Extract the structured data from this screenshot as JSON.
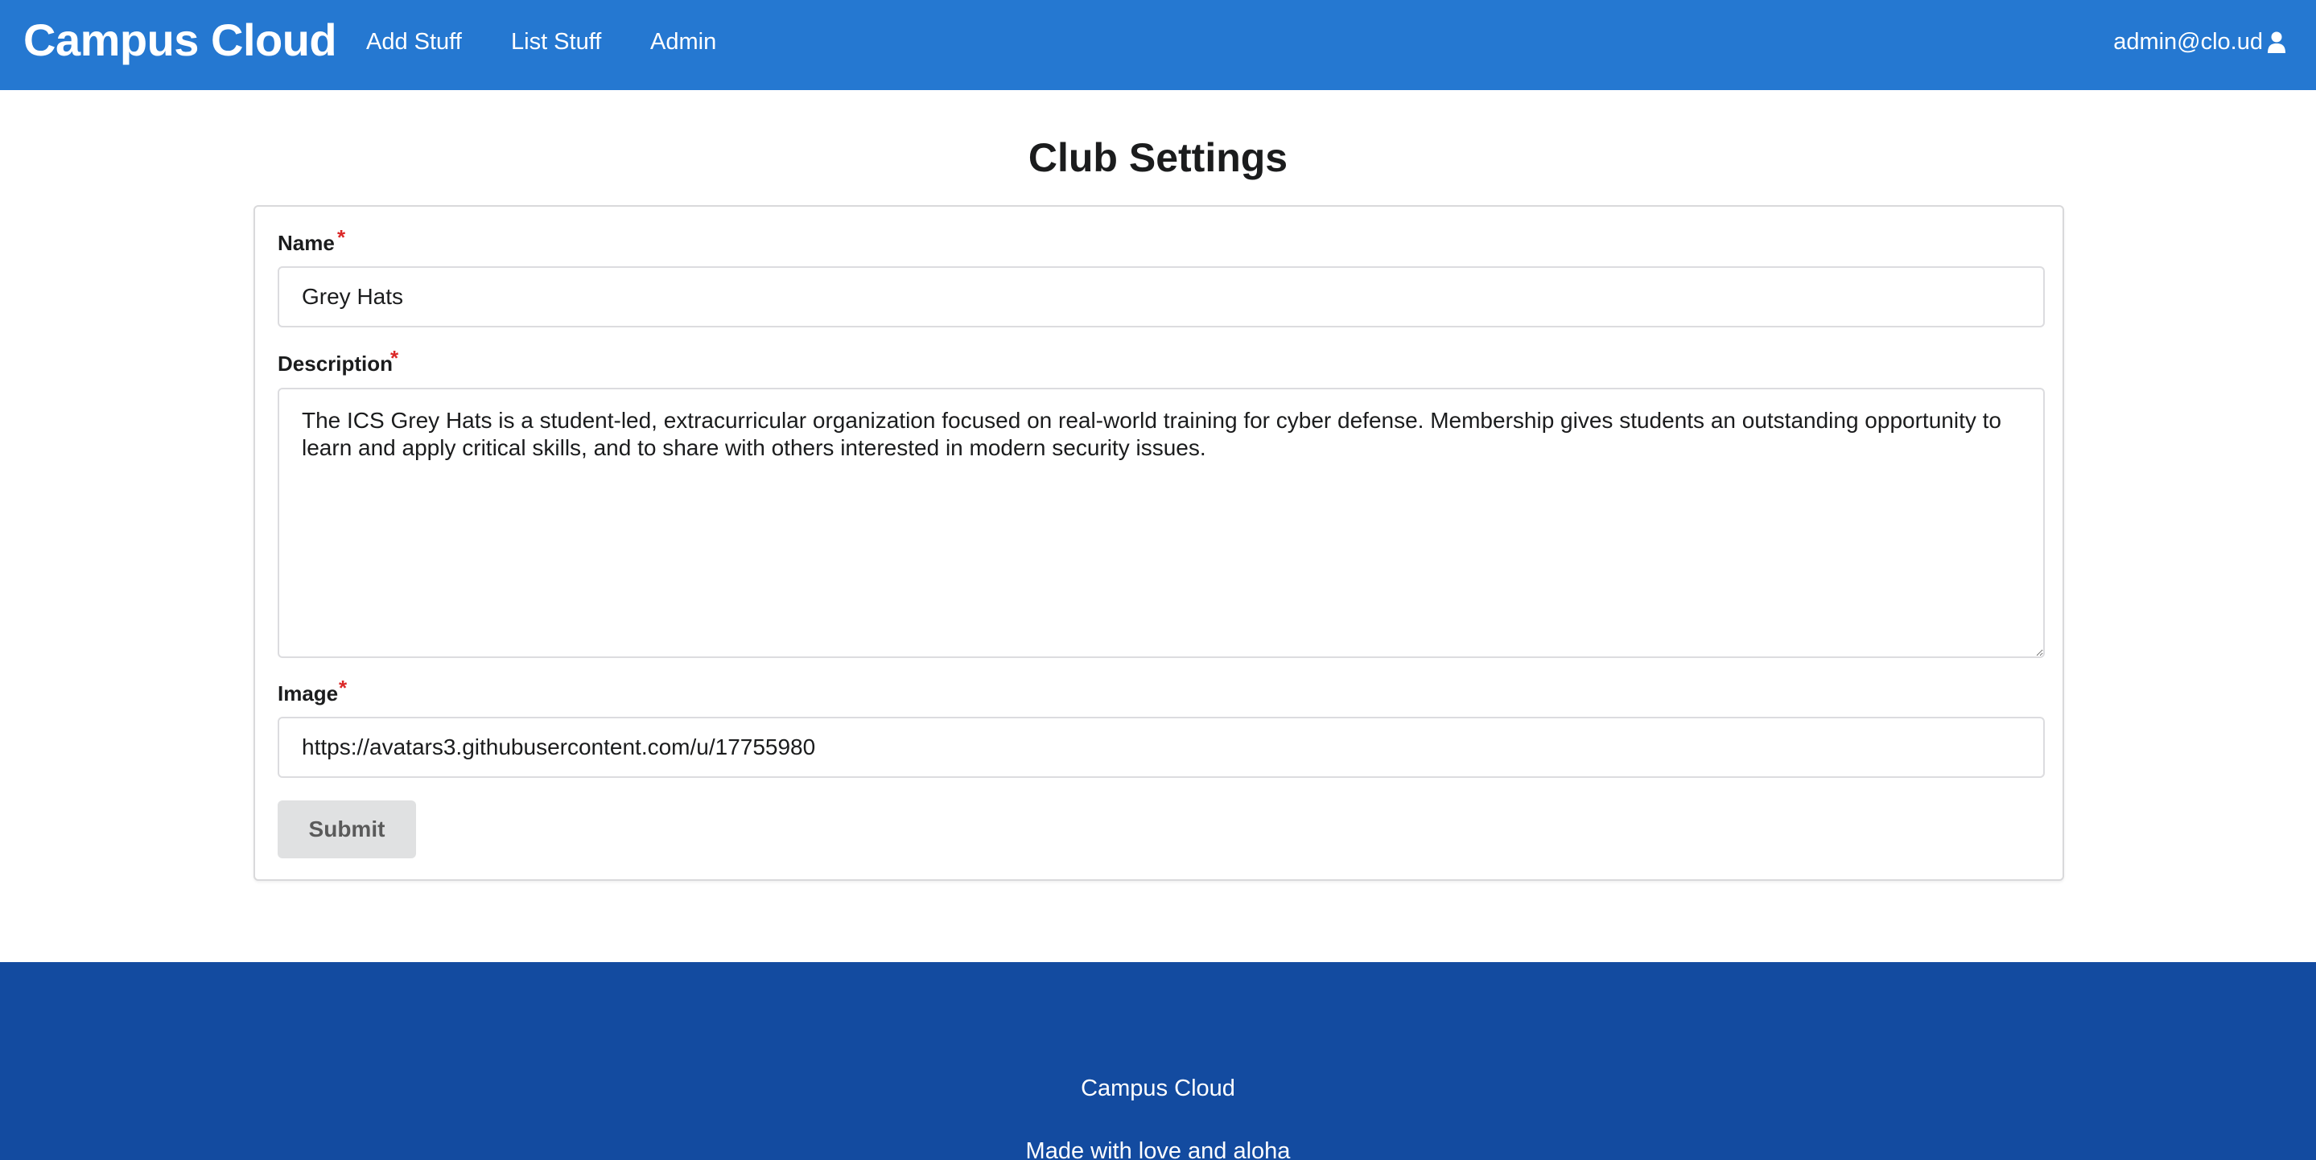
{
  "navbar": {
    "brand": "Campus Cloud",
    "links": [
      "Add Stuff",
      "List Stuff",
      "Admin"
    ],
    "user": "admin@clo.ud",
    "user_icon": "user-icon"
  },
  "page": {
    "title": "Club Settings"
  },
  "form": {
    "name_label": "Name",
    "name_value": "Grey Hats",
    "description_label": "Description",
    "description_value": "The ICS Grey Hats is a student-led, extracurricular organization focused on real-world training for cyber defense. Membership gives students an outstanding opportunity to learn and apply critical skills, and to share with others interested in modern security issues.",
    "image_label": "Image",
    "image_value": "https://avatars3.githubusercontent.com/u/17755980",
    "required_marker": "*",
    "submit_label": "Submit"
  },
  "footer": {
    "line1": "Campus Cloud",
    "line2": "Made with love and aloha"
  },
  "colors": {
    "navbar": "#2578d1",
    "footer": "#134ba0",
    "required": "#db2828"
  }
}
